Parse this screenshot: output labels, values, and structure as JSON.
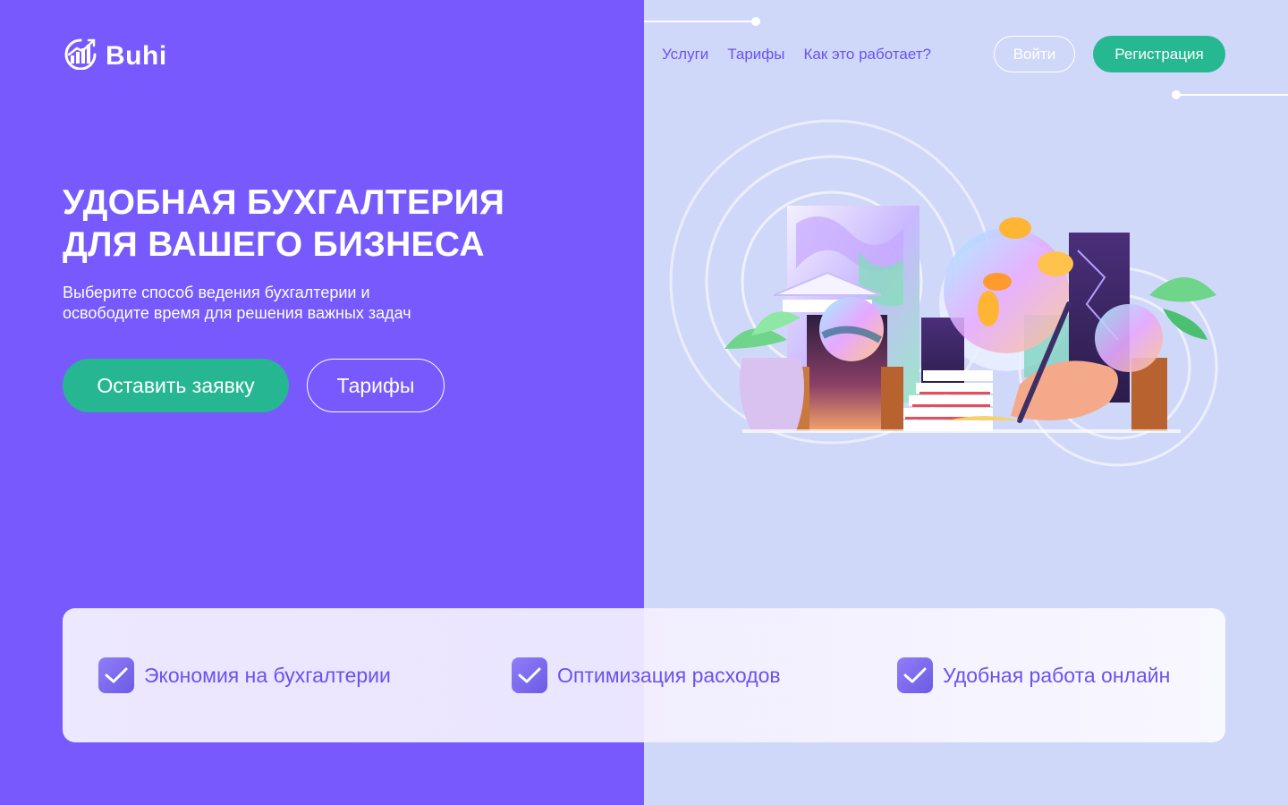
{
  "brand": {
    "name": "Buhi",
    "logo_icon": "chart-growth-icon"
  },
  "nav": {
    "items": [
      {
        "label": "Услуги"
      },
      {
        "label": "Тарифы"
      },
      {
        "label": "Как это работает?"
      }
    ],
    "login_label": "Войти",
    "register_label": "Регистрация"
  },
  "hero": {
    "title_line1": "УДОБНАЯ БУХГАЛТЕРИЯ",
    "title_line2": "ДЛЯ ВАШЕГО БИЗНЕСА",
    "subtitle_line1": "Выберите способ ведения бухгалтерии и",
    "subtitle_line2": "освободите время для решения важных задач",
    "primary_button": "Оставить заявку",
    "secondary_button": "Тарифы"
  },
  "features": [
    {
      "label": "Экономия на бухгалтерии",
      "icon": "checkbox-checked-icon"
    },
    {
      "label": "Оптимизация расходов",
      "icon": "checkbox-checked-icon"
    },
    {
      "label": "Удобная работа онлайн",
      "icon": "checkbox-checked-icon"
    }
  ],
  "colors": {
    "primary_purple": "#7759fd",
    "light_lavender": "#d0d8fa",
    "accent_green": "#25b891",
    "link_purple": "#6a52f0"
  }
}
